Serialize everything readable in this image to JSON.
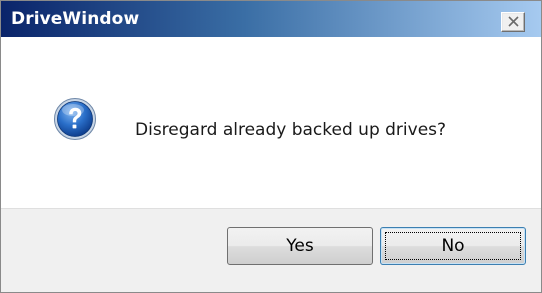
{
  "window": {
    "title": "DriveWindow",
    "close_icon": "close-icon"
  },
  "message": {
    "icon": "question-icon",
    "text": "Disregard already backed up drives?"
  },
  "buttons": {
    "yes_label": "Yes",
    "no_label": "No",
    "focused": "No"
  },
  "colors": {
    "title_gradient_start": "#0a246a",
    "title_gradient_end": "#a6caf0",
    "footer_background": "#f0f0f0",
    "question_icon_blue": "#1f5fb8"
  }
}
